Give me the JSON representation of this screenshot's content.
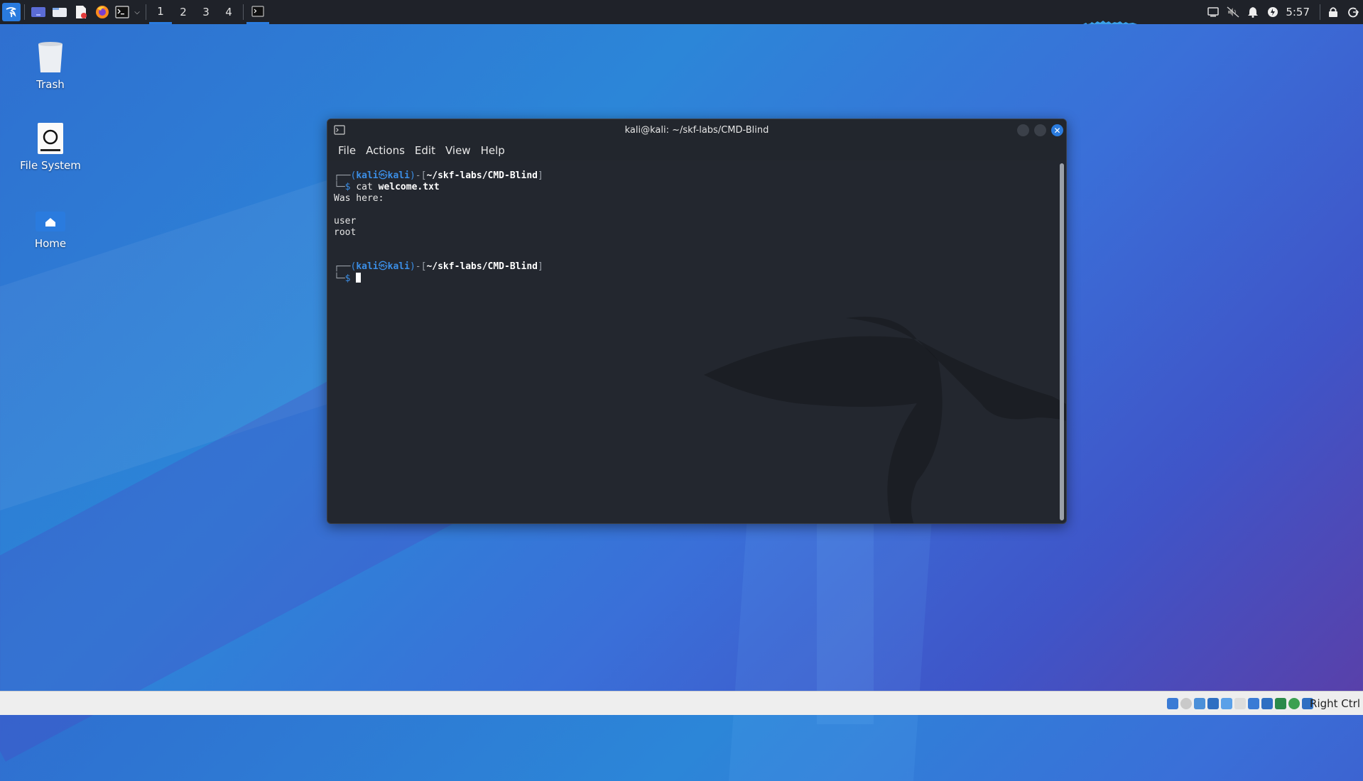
{
  "taskbar": {
    "workspaces": [
      "1",
      "2",
      "3",
      "4"
    ],
    "active_workspace": "1",
    "clock": "5:57"
  },
  "desktop": {
    "icons": [
      {
        "label": "Trash"
      },
      {
        "label": "File System"
      },
      {
        "label": "Home"
      }
    ]
  },
  "terminal": {
    "title": "kali@kali: ~/skf-labs/CMD-Blind",
    "menu": [
      "File",
      "Actions",
      "Edit",
      "View",
      "Help"
    ],
    "prompt_user": "kali",
    "prompt_symbol": "㉿",
    "prompt_host": "kali",
    "prompt_path": "~/skf-labs/CMD-Blind",
    "command_1_name": "cat",
    "command_1_arg": "welcome.txt",
    "output": [
      "Was here:",
      "",
      "user",
      "root"
    ]
  },
  "vbox_bar": {
    "host_key": "Right Ctrl"
  },
  "colors": {
    "accent": "#2a7bde",
    "terminal_bg": "#23272f",
    "panel_bg": "#1f2229"
  }
}
